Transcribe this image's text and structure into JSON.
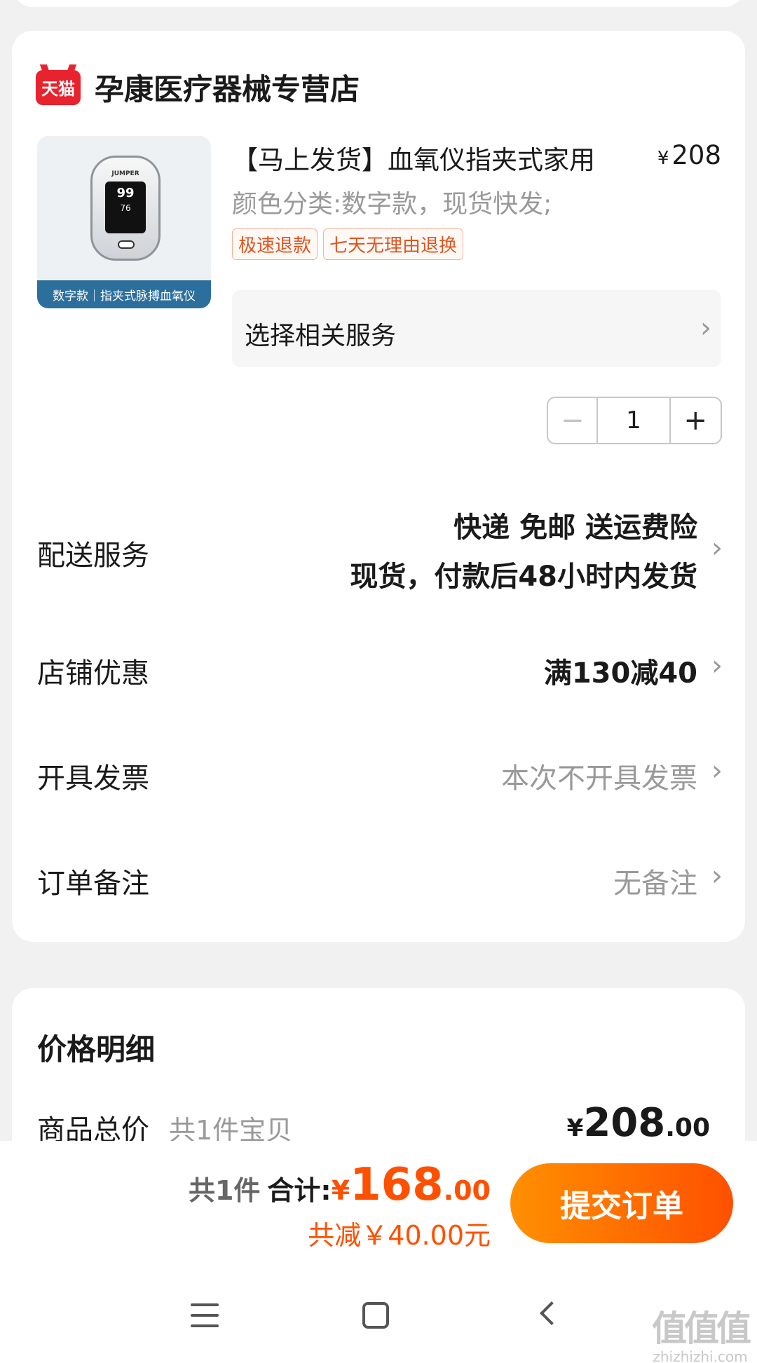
{
  "store": {
    "platform_logo": "天猫",
    "name": "孕康医疗器械专营店"
  },
  "product": {
    "thumbnail": {
      "brand": "JUMPER",
      "reading_1": "99",
      "reading_2": "76",
      "caption": "数字款｜指夹式脉搏血氧仪"
    },
    "title": "【马上发货】血氧仪指夹式家用",
    "price_currency": "¥",
    "price": "208",
    "spec": "颜色分类:数字款，现货快发;",
    "tags": [
      "极速退款",
      "七天无理由退换"
    ],
    "service_label": "选择相关服务",
    "quantity": "1",
    "minus_icon": "minus-icon",
    "plus_icon": "plus-icon"
  },
  "rows": {
    "delivery_label": "配送服务",
    "delivery_line1": "快递 免邮 送运费险",
    "delivery_line2": "现货，付款后48小时内发货",
    "discount_label": "店铺优惠",
    "discount_value": "满130减40",
    "invoice_label": "开具发票",
    "invoice_value": "本次不开具发票",
    "note_label": "订单备注",
    "note_value": "无备注"
  },
  "price_detail": {
    "title": "价格明细",
    "total_label": "商品总价",
    "total_count": "共1件宝贝",
    "total_currency": "¥",
    "total_int": "208",
    "total_dec": ".00"
  },
  "bottom_bar": {
    "count": "共1件",
    "sum_label": "合计:",
    "sum_currency": "¥",
    "sum_int": "168",
    "sum_dec": ".00",
    "discount": "共减￥40.00元",
    "submit": "提交订单",
    "accent_color": "#ff5000"
  },
  "watermark": {
    "icon": "值值值",
    "text": "zhizhizhi.com"
  }
}
